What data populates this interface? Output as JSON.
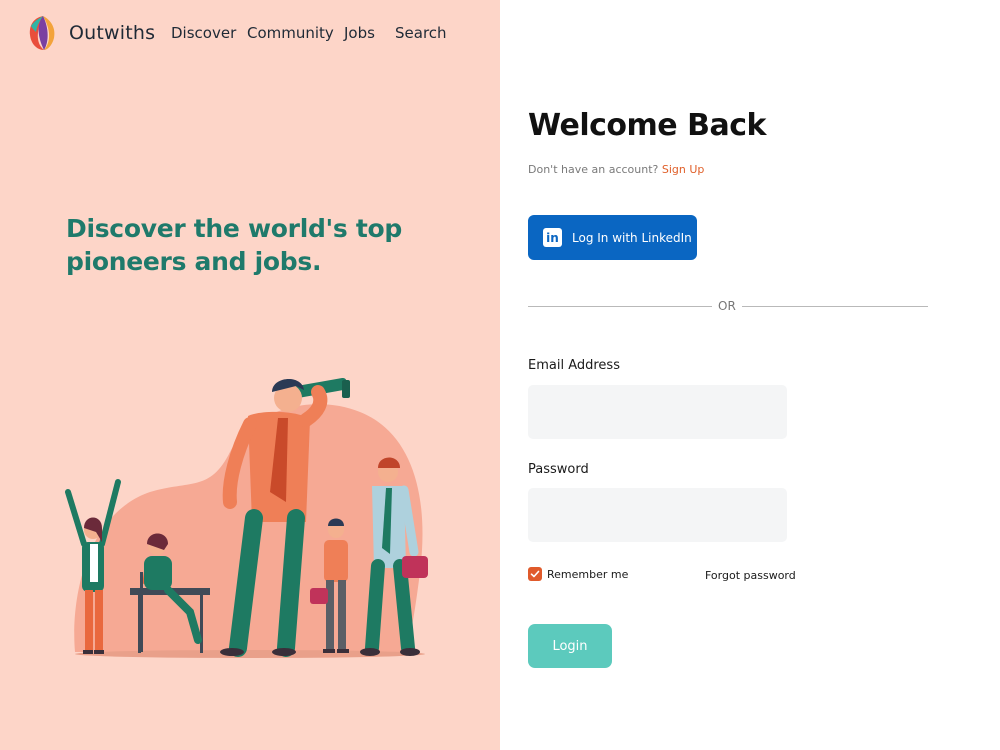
{
  "brand": {
    "name": "Outwiths"
  },
  "nav": {
    "items": [
      {
        "label": "Discover"
      },
      {
        "label": "Community"
      },
      {
        "label": "Jobs"
      },
      {
        "label": "Search"
      }
    ]
  },
  "hero": {
    "headline": "Discover the world's top pioneers and jobs."
  },
  "login": {
    "title": "Welcome Back",
    "no_account_text": "Don't have an account?",
    "signup_link": "Sign Up",
    "linkedin_icon": "in",
    "linkedin_button": "Log In with LinkedIn",
    "or_text": "OR",
    "email_label": "Email Address",
    "email_value": "",
    "password_label": "Password",
    "password_value": "",
    "remember_label": "Remember me",
    "remember_checked": true,
    "forgot_label": "Forgot password",
    "login_button": "Login"
  },
  "colors": {
    "left_bg": "#fdd5c8",
    "headline": "#1f7a6b",
    "linkedin": "#0a66c2",
    "accent_orange": "#e05a2b",
    "login_button": "#5ccabd",
    "input_bg": "#f4f5f6"
  },
  "icons": [
    "logo-icon",
    "linkedin-icon",
    "checkmark-icon"
  ]
}
